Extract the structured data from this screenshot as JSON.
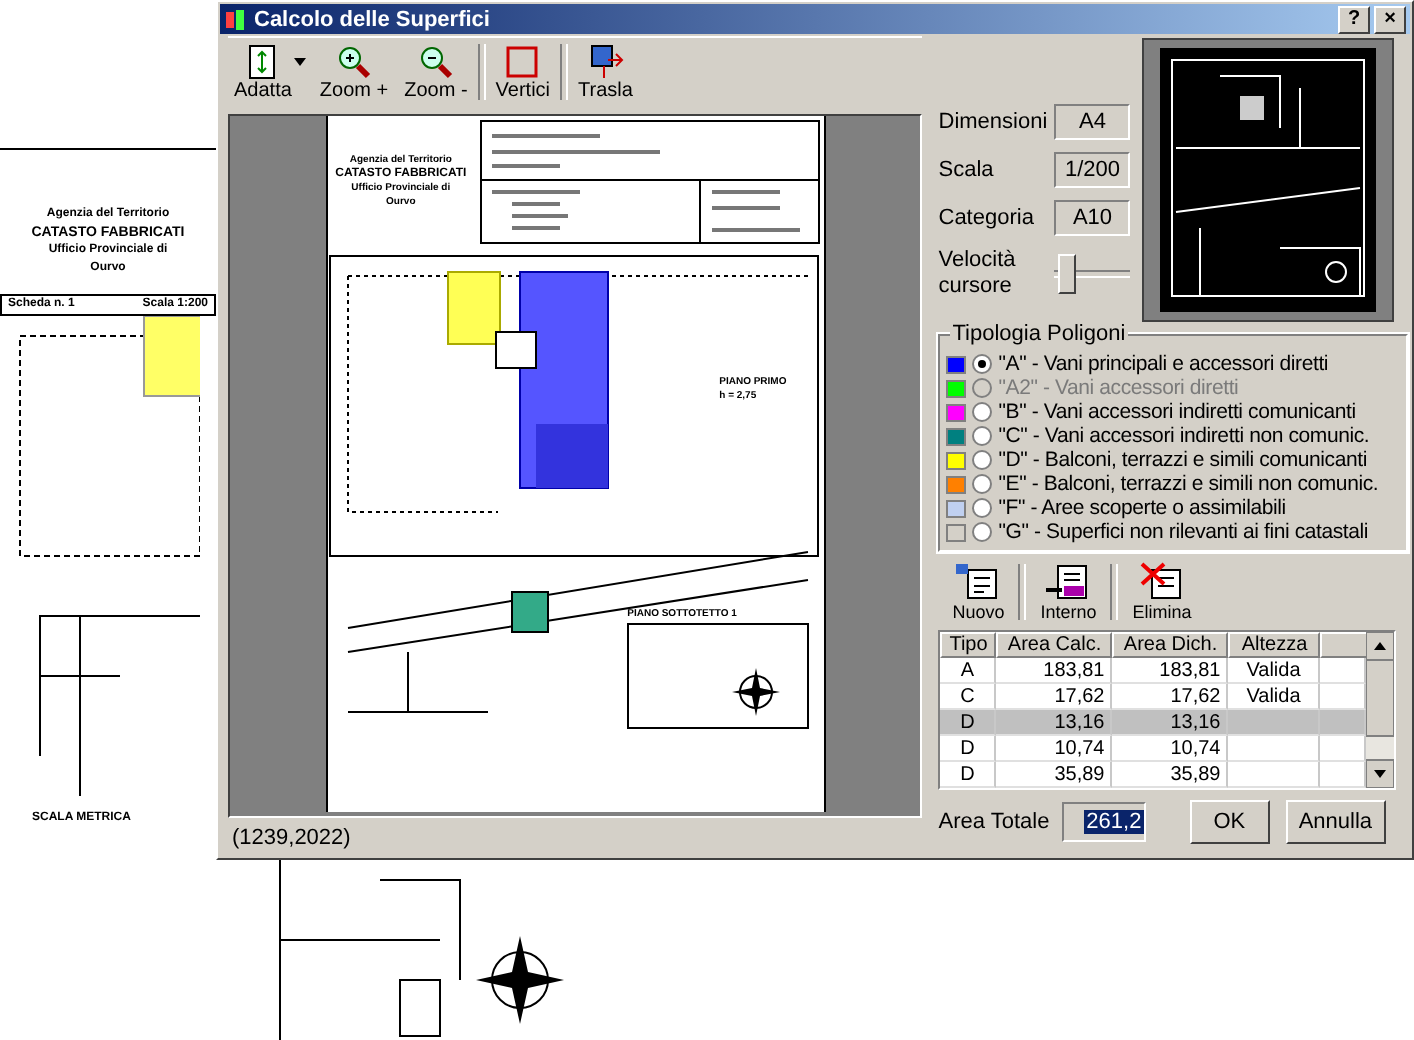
{
  "background_document": {
    "header": [
      "Agenzia del Territorio",
      "CATASTO FABBRICATI",
      "Ufficio Provinciale di",
      "Ourvo"
    ],
    "sheet": "Scheda n. 1",
    "scale": "Scala 1:200",
    "footer": "SCALA METRICA"
  },
  "window": {
    "title": "Calcolo delle Superfici",
    "title_buttons": [
      "?",
      "×"
    ]
  },
  "toolbar": [
    {
      "kind": "fit",
      "label": "Adatta",
      "dropdown": true
    },
    {
      "kind": "zoom_in",
      "label": "Zoom +",
      "dropdown": false
    },
    {
      "kind": "zoom_out",
      "label": "Zoom -",
      "dropdown": false
    },
    {
      "kind": "vertices",
      "label": "Vertici",
      "dropdown": false
    },
    {
      "kind": "move",
      "label": "Trasla",
      "dropdown": false
    }
  ],
  "preview": {
    "header": [
      "Agenzia del Territorio",
      "CATASTO FABBRICATI",
      "Ufficio Provinciale di",
      "Ourvo"
    ],
    "floor_labels": [
      "PIANO PRIMO",
      "h = 2,75",
      "PIANO SOTTOTETTO 1"
    ],
    "coordinates": "(1239,2022)"
  },
  "properties": [
    {
      "label": "Dimensioni",
      "value": "A4"
    },
    {
      "label": "Scala",
      "value": "1/200"
    },
    {
      "label": "Categoria",
      "value": "A10"
    }
  ],
  "slider": {
    "label": "Velocità cursore",
    "level": 0.05
  },
  "polygon_types": {
    "title": "Tipologia Poligoni",
    "items": [
      {
        "label": "\"A\" - Vani principali e accessori diretti",
        "color": "#0000ff",
        "selected": true,
        "disabled": false
      },
      {
        "label": "\"A2\" - Vani accessori diretti",
        "color": "#00ff00",
        "selected": false,
        "disabled": true
      },
      {
        "label": "\"B\" - Vani accessori indiretti comunicanti",
        "color": "#ff00ff",
        "selected": false,
        "disabled": false
      },
      {
        "label": "\"C\" - Vani accessori indiretti non comunic.",
        "color": "#008080",
        "selected": false,
        "disabled": false
      },
      {
        "label": "\"D\" - Balconi, terrazzi e simili comunicanti",
        "color": "#ffff00",
        "selected": false,
        "disabled": false
      },
      {
        "label": "\"E\" - Balconi, terrazzi e simili non comunic.",
        "color": "#ff8000",
        "selected": false,
        "disabled": false
      },
      {
        "label": "\"F\" - Aree scoperte o assimilabili",
        "color": "#c0d0f0",
        "selected": false,
        "disabled": false
      },
      {
        "label": "\"G\" - Superfici non rilevanti ai fini catastali",
        "color": "#d4d0c8",
        "selected": false,
        "disabled": false
      }
    ]
  },
  "actions": [
    {
      "kind": "new",
      "label": "Nuovo"
    },
    {
      "kind": "inner",
      "label": "Interno"
    },
    {
      "kind": "delete",
      "label": "Elimina"
    }
  ],
  "table": {
    "columns": [
      "Tipo",
      "Area Calc.",
      "Area Dich.",
      "Altezza"
    ],
    "rows": [
      {
        "cells": [
          "A",
          "183,81",
          "183,81",
          "Valida"
        ],
        "selected": false
      },
      {
        "cells": [
          "C",
          "17,62",
          "17,62",
          "Valida"
        ],
        "selected": false
      },
      {
        "cells": [
          "D",
          "13,16",
          "13,16",
          ""
        ],
        "selected": true
      },
      {
        "cells": [
          "D",
          "10,74",
          "10,74",
          ""
        ],
        "selected": false
      },
      {
        "cells": [
          "D",
          "35,89",
          "35,89",
          ""
        ],
        "selected": false
      }
    ]
  },
  "total": {
    "label": "Area Totale",
    "value": "261,2",
    "highlighted": true
  },
  "buttons": [
    "OK",
    "Annulla"
  ]
}
